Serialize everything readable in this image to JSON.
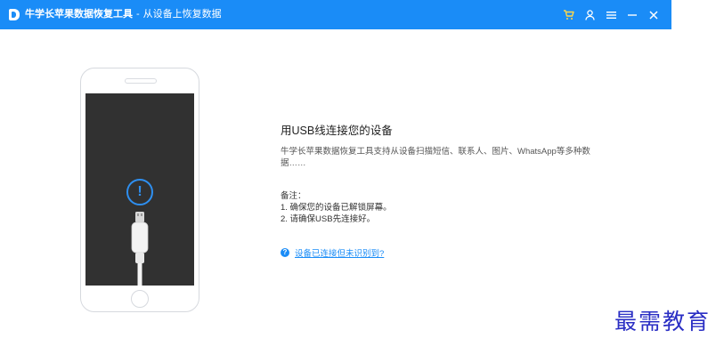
{
  "app": {
    "name": "牛学长苹果数据恢复工具",
    "separator": "-",
    "subtitle": "从设备上恢复数据"
  },
  "title_bar": {
    "bg_color": "#1a8cf7",
    "controls": [
      {
        "name": "cart-icon",
        "glyph": "🛒"
      },
      {
        "name": "user-icon",
        "glyph": "👤"
      },
      {
        "name": "menu-icon",
        "glyph": "≡"
      },
      {
        "name": "minimize-icon",
        "glyph": "−"
      },
      {
        "name": "close-icon",
        "glyph": "✕"
      }
    ]
  },
  "device": {
    "alert_icon": "!",
    "alert_color": "#2e8ff0"
  },
  "connect": {
    "heading": "用USB线连接您的设备",
    "description": "牛学长苹果数据恢复工具支持从设备扫描短信、联系人、图片、WhatsApp等多种数据……",
    "notes_title": "备注：",
    "notes": [
      "1. 确保您的设备已解锁屏幕。",
      "2. 请确保USB先连接好。"
    ],
    "help_link": "设备已连接但未识别到?"
  },
  "watermark": "最需教育"
}
